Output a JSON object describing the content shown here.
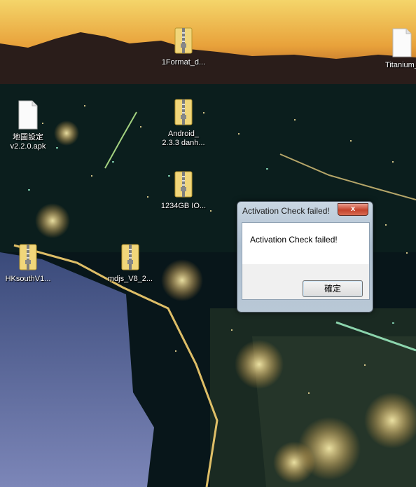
{
  "desktop": {
    "icons": [
      {
        "label": "1Format_d...",
        "type": "zip-folder-icon"
      },
      {
        "label": "Titanium_",
        "type": "file-icon"
      },
      {
        "label": "地圖設定\nv2.2.0.apk",
        "type": "file-icon"
      },
      {
        "label": "Android_\n2.3.3 danh...",
        "type": "zip-folder-icon"
      },
      {
        "label": "1234GB IO...",
        "type": "zip-folder-icon"
      },
      {
        "label": "HKsouthV1...",
        "type": "zip-folder-icon"
      },
      {
        "label": "mdjs_V8_2...",
        "type": "zip-folder-icon"
      }
    ]
  },
  "dialog": {
    "title": "Activation Check failed!",
    "close": "x",
    "message": "Activation Check failed!",
    "ok_label": "確定"
  },
  "colors": {
    "dialog_frame": "#b9c8d6",
    "close_button": "#c4432c"
  }
}
